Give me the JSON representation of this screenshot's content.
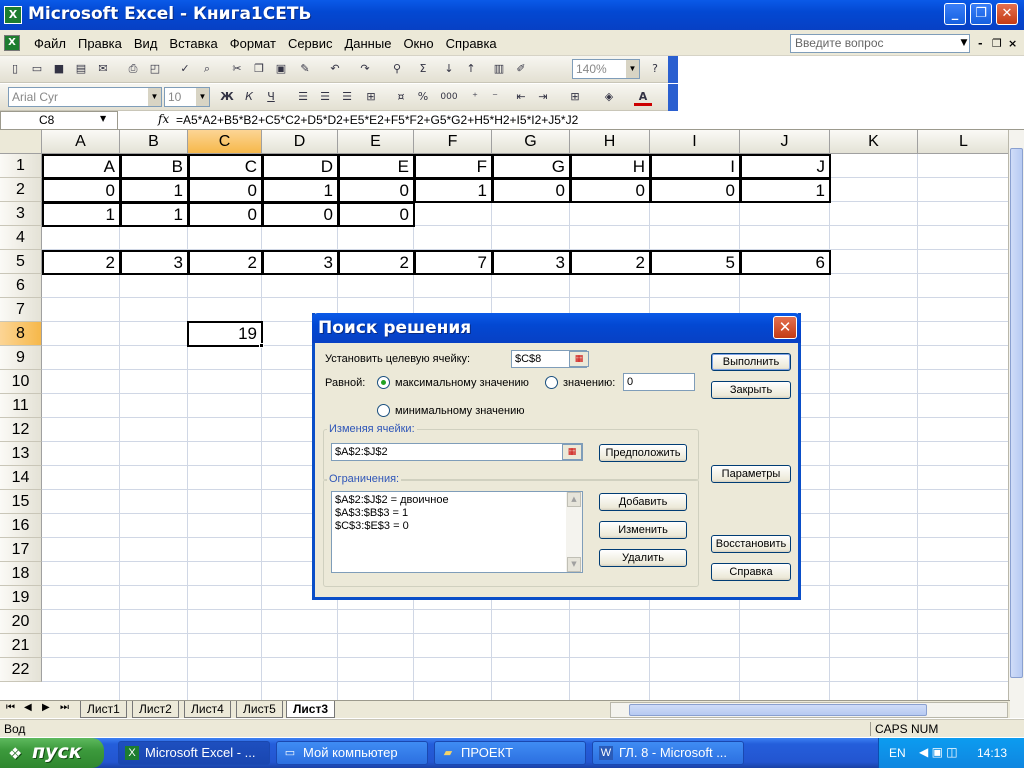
{
  "window": {
    "title": "Microsoft Excel - Книга1СЕТЬ",
    "app_icon": "excel-icon",
    "buttons": {
      "minimize": "_",
      "maximize": "❐",
      "close": "✕"
    }
  },
  "menu": {
    "items": [
      "Файл",
      "Правка",
      "Вид",
      "Вставка",
      "Формат",
      "Сервис",
      "Данные",
      "Окно",
      "Справка"
    ],
    "help_placeholder": "Введите вопрос",
    "mdi": {
      "minimize": "-",
      "restore": "❐",
      "close": "×"
    }
  },
  "toolbar": {
    "zoom": "140%",
    "font": "Arial Cyr",
    "size": "10",
    "bold": "Ж",
    "italic": "К",
    "underline": "Ч",
    "percent": "%",
    "thousands": "000",
    "sum": "Σ",
    "fx_label": "f",
    "borders_icon": "borders-icon",
    "fill_icon": "fill-color-icon",
    "font_color_letter": "A",
    "accent_color": "#2a5fd0"
  },
  "formula_bar": {
    "name_box": "C8",
    "fx": "fx",
    "formula": "=A5*A2+B5*B2+C5*C2+D5*D2+E5*E2+F5*F2+G5*G2+H5*H2+I5*I2+J5*J2"
  },
  "sheet": {
    "columns": [
      "A",
      "B",
      "C",
      "D",
      "E",
      "F",
      "G",
      "H",
      "I",
      "J",
      "K",
      "L"
    ],
    "selected_column": "C",
    "selected_row": 8,
    "rows": [
      1,
      2,
      3,
      4,
      5,
      6,
      7,
      8,
      9,
      10,
      11,
      12,
      13,
      14,
      15,
      16,
      17,
      18,
      19,
      20,
      21,
      22
    ],
    "cells": {
      "row1": [
        "A",
        "B",
        "C",
        "D",
        "E",
        "F",
        "G",
        "H",
        "I",
        "J"
      ],
      "row2": [
        "0",
        "1",
        "0",
        "1",
        "0",
        "1",
        "0",
        "0",
        "0",
        "1"
      ],
      "row3": [
        "1",
        "1",
        "0",
        "0",
        "0"
      ],
      "row5": [
        "2",
        "3",
        "2",
        "3",
        "2",
        "7",
        "3",
        "2",
        "5",
        "6"
      ],
      "c8": "19"
    }
  },
  "tabs": {
    "nav": [
      "⏮",
      "◀",
      "▶",
      "⏭"
    ],
    "sheets": [
      "Лист1",
      "Лист2",
      "Лист4",
      "Лист5",
      "Лист3"
    ],
    "active": "Лист3"
  },
  "status": {
    "ready": "Вод",
    "caps": "CAPS NUM"
  },
  "taskbar": {
    "start": "пуск",
    "tasks": [
      "Microsoft Excel - ...",
      "Мой компьютер",
      "ПРОЕКТ",
      "ГЛ.  8 - Microsoft ..."
    ],
    "lang": "EN",
    "clock": "14:13"
  },
  "solver": {
    "title": "Поиск решения",
    "target_label": "Установить целевую ячейку:",
    "target_value": "$C$8",
    "equal_label": "Равной:",
    "opt_max": "максимальному значению",
    "opt_value": "значению:",
    "value_field": "0",
    "opt_min": "минимальному значению",
    "changing_label": "Изменяя ячейки:",
    "changing_value": "$A$2:$J$2",
    "guess_button": "Предположить",
    "constraints_label": "Ограничения:",
    "constraints": [
      "$A$2:$J$2 = двоичное",
      "$A$3:$B$3 = 1",
      "$C$3:$E$3 = 0"
    ],
    "add_button": "Добавить",
    "change_button": "Изменить",
    "delete_button": "Удалить",
    "solve_button": "Выполнить",
    "close_button": "Закрыть",
    "options_button": "Параметры",
    "reset_button": "Восстановить",
    "help_button": "Справка",
    "selected_option": "max"
  }
}
